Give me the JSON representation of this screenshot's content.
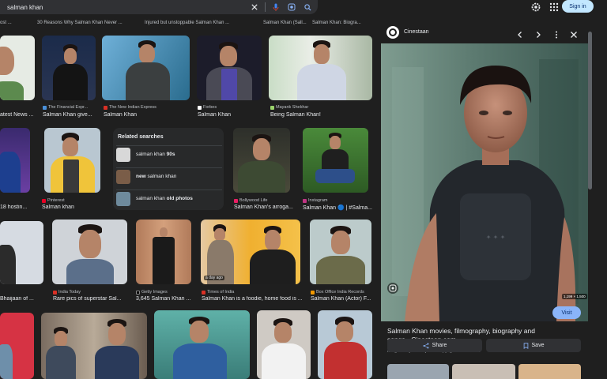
{
  "search": {
    "query": "salman khan"
  },
  "header": {
    "signin_label": "Sign in"
  },
  "top_labels": [
    "ost ...",
    "30 Reasons Why Salman Khan Never ...",
    "Injured but unstoppable Salman Khan ...",
    "Salman Khan (Sall...",
    "Salman Khan: Biogra..."
  ],
  "row1": [
    {
      "source": "",
      "caption": "atest News ..."
    },
    {
      "source": "The Financial Expr...",
      "caption": "Salman Khan give..."
    },
    {
      "source": "The New Indian Express",
      "caption": "Salman Khan"
    },
    {
      "source": "Forbes",
      "caption": "Salman Khan"
    },
    {
      "source": "Mayank Shekhar",
      "caption": "Being Salman Khan!"
    }
  ],
  "row2": [
    {
      "source": "",
      "caption": "18 hostin..."
    },
    {
      "source": "Pinterest",
      "caption": "Salman khan"
    },
    {
      "source": "Bollywood Life",
      "caption": "Salman Khan's arroga..."
    },
    {
      "source": "Instagram",
      "caption": "Salman Khan 🔵 | #Salma..."
    }
  ],
  "related": {
    "title": "Related searches",
    "items": [
      {
        "prefix": "salman khan ",
        "bold": "90s"
      },
      {
        "prefix": "",
        "bold": "new",
        "suffix": " salman khan"
      },
      {
        "prefix": "salman khan ",
        "bold": "old photos"
      }
    ]
  },
  "row3": [
    {
      "source": "",
      "caption": "Bhaijaan of ..."
    },
    {
      "source": "India Today",
      "caption": "Rare pics of superstar Sal..."
    },
    {
      "source": "Getty Images",
      "caption": "3,645 Salman Khan ..."
    },
    {
      "source": "Times of India",
      "caption": "Salman Khan is a foodie, home food is ..."
    },
    {
      "source": "Box Office India Records",
      "caption": "Salman Khan (Actor) F..."
    }
  ],
  "row3_badge": "a day ago",
  "panel": {
    "site": "Cinestaan",
    "title": "Salman Khan movies, filmography, biography and songs - Cinestaan.com",
    "copyright_note": "Images may be subject to copyright.",
    "learn_more": "Learn More",
    "visit_label": "Visit",
    "share_label": "Share",
    "save_label": "Save",
    "dimensions": "1,199 × 1,500"
  },
  "colors": {
    "accent": "#8ab4f8",
    "signin_bg": "#c2e7ff",
    "bg": "#1f1f1f"
  }
}
